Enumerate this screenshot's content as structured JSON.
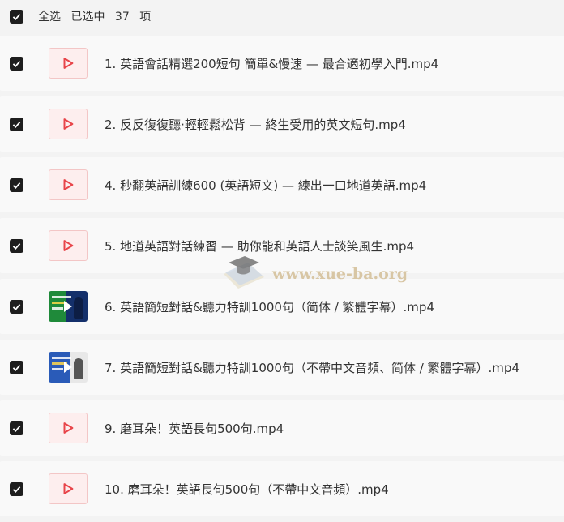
{
  "header": {
    "select_all": "全选",
    "selected_prefix": "已选中",
    "selected_count": "37",
    "selected_suffix": "项"
  },
  "files": [
    {
      "name": "1. 英語會話精選200短句 簡單&慢速 — 最合適初學入門.mp4",
      "thumb": "play-file-icon"
    },
    {
      "name": "2. 反反復復聽·輕輕鬆松背 — 終生受用的英文短句.mp4",
      "thumb": "play-file-icon"
    },
    {
      "name": "4. 秒翻英語訓練600 (英語短文) — 練出一口地道英語.mp4",
      "thumb": "play-file-icon"
    },
    {
      "name": "5. 地道英語對話練習 — 助你能和英語人士談笑風生.mp4",
      "thumb": "play-file-icon"
    },
    {
      "name": "6. 英語簡短對話&聽力特訓1000句（简体 / 繁體字幕）.mp4",
      "thumb": "video-thumbnail"
    },
    {
      "name": "7. 英語簡短對話&聽力特訓1000句（不帶中文音頻、简体 / 繁體字幕）.mp4",
      "thumb": "video-thumbnail"
    },
    {
      "name": "9. 磨耳朵！英語長句500句.mp4",
      "thumb": "play-file-icon"
    },
    {
      "name": "10. 磨耳朵！英語長句500句（不帶中文音頻）.mp4",
      "thumb": "play-file-icon"
    }
  ],
  "watermark": {
    "text": "www.xue-ba.org"
  },
  "colors": {
    "accent_red": "#e8454a",
    "checkbox": "#1e1e1e"
  }
}
